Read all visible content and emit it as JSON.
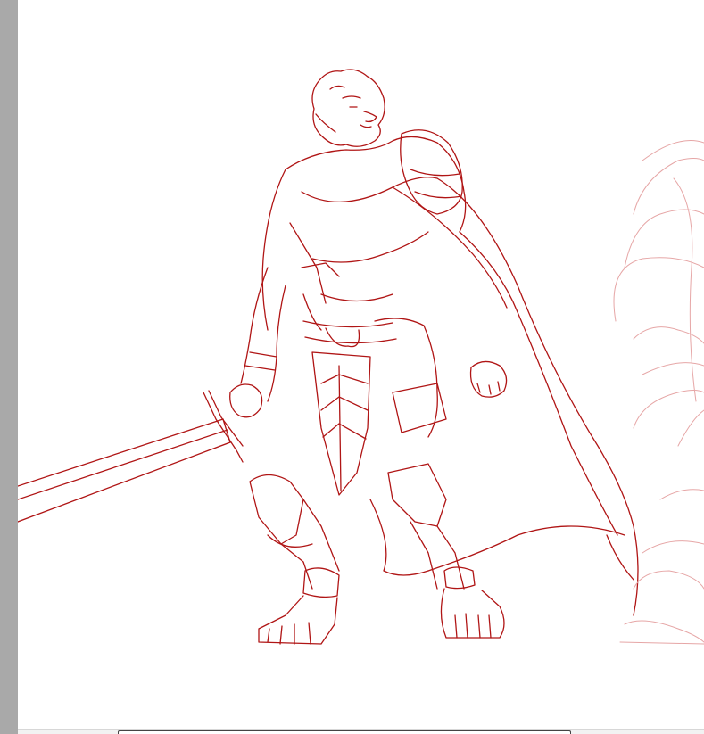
{
  "canvas": {
    "background": "#ffffff",
    "line_color": "#b01515",
    "faint_line_color": "#e6a6a6",
    "artwork": "lion-knight-sketch",
    "secondary_artwork": "faint-sketch-right"
  },
  "ui": {
    "gutter_color": "#a9a9a9",
    "scrollbar_thumb_border": "#444444"
  }
}
